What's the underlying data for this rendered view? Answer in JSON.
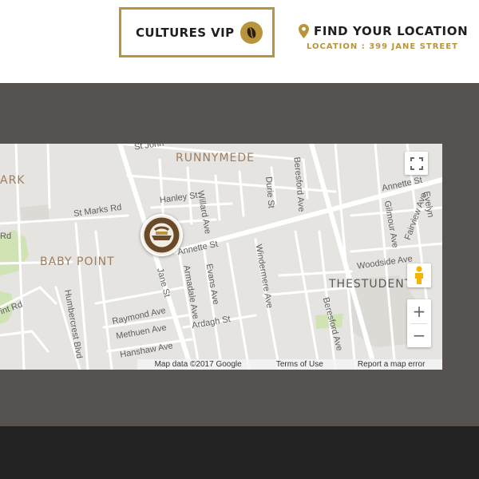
{
  "header": {
    "vip_label": "CULTURES VIP",
    "location_title": "FIND YOUR LOCATION",
    "location_sub": "LOCATION : 399 JANE STREET"
  },
  "map": {
    "districts": {
      "runnymede": "RUNNYMEDE",
      "baby_point": "BABY POINT",
      "park_partial": "ARK",
      "student": "THESTUDENT"
    },
    "streets": {
      "st_john": "St John",
      "st_marks": "St Marks Rd",
      "hanley": "Hanley St",
      "willard": "Willard Ave",
      "durie": "Durie St",
      "beresford_top": "Beresford Ave",
      "annette_right": "Annette St",
      "annette_mid": "Annette St",
      "evelyn": "Evelyn",
      "fairview": "Fairview Ave",
      "gilmour": "Gilmour Ave",
      "woodside": "Woodside Ave",
      "jane": "Jane St",
      "armadale": "Armadale Ave",
      "evans": "Evans Ave",
      "windermere": "Windermere Ave",
      "raymond": "Raymond Ave",
      "methuen": "Methuen Ave",
      "ardagh": "Ardagh St",
      "hanshaw": "Hanshaw Ave",
      "humbercrest": "Humbercrest Blvd",
      "beresford_bottom": "Beresford Ave",
      "rd_left": "Rd",
      "int_rd": "int Rd"
    },
    "zoom_in": "+",
    "zoom_out": "−",
    "attribution": {
      "map_data": "Map data ©2017 Google",
      "terms": "Terms of Use",
      "report": "Report a map error"
    }
  },
  "colors": {
    "gold": "#b8953a",
    "band": "#565250",
    "footer": "#222222",
    "district_text": "#9c7e62",
    "park": "#cfe3b4"
  },
  "icons": {
    "pin": "map-pin-icon",
    "bean": "coffee-bean-icon",
    "fullscreen": "fullscreen-icon",
    "pegman": "pegman-icon",
    "marker": "coffee-culture-logo"
  }
}
